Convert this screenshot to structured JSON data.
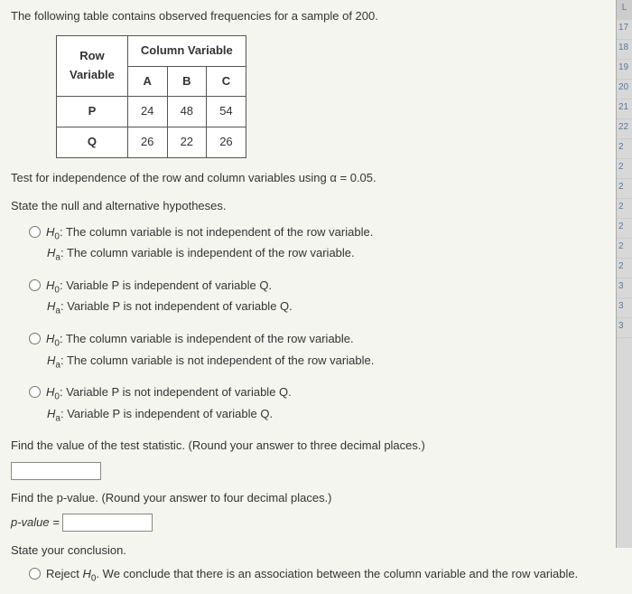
{
  "intro": "The following table contains observed frequencies for a sample of 200.",
  "table": {
    "col_group_header": "Column Variable",
    "row_header": "Row\nVariable",
    "cols": [
      "A",
      "B",
      "C"
    ],
    "rows": [
      {
        "label": "P",
        "cells": [
          "24",
          "48",
          "54"
        ]
      },
      {
        "label": "Q",
        "cells": [
          "26",
          "22",
          "26"
        ]
      }
    ]
  },
  "test_prompt": "Test for independence of the row and column variables using α = 0.05.",
  "hypo_prompt": "State the null and alternative hypotheses.",
  "options": [
    {
      "h0": "The column variable is not independent of the row variable.",
      "ha": "The column variable is independent of the row variable."
    },
    {
      "h0": "Variable P is independent of variable Q.",
      "ha": "Variable P is not independent of variable Q."
    },
    {
      "h0": "The column variable is independent of the row variable.",
      "ha": "The column variable is not independent of the row variable."
    },
    {
      "h0": "Variable P is not independent of variable Q.",
      "ha": "Variable P is independent of variable Q."
    }
  ],
  "teststat_prompt": "Find the value of the test statistic. (Round your answer to three decimal places.)",
  "pvalue_prompt": "Find the p-value. (Round your answer to four decimal places.)",
  "pvalue_label": "p-value =",
  "conclusion_prompt": "State your conclusion.",
  "conclusion_option": "We conclude that there is an association between the column variable and the row variable.",
  "reject_label": "Reject",
  "h0_label": "H",
  "h0_sub": "0",
  "ha_label": "H",
  "ha_sub": "a",
  "sidebar_letter": "L",
  "sidebar_nums": [
    "17",
    "18",
    "19",
    "20",
    "21",
    "22",
    "2",
    "2",
    "2",
    "2",
    "2",
    "2",
    "2",
    "3",
    "3",
    "3"
  ]
}
